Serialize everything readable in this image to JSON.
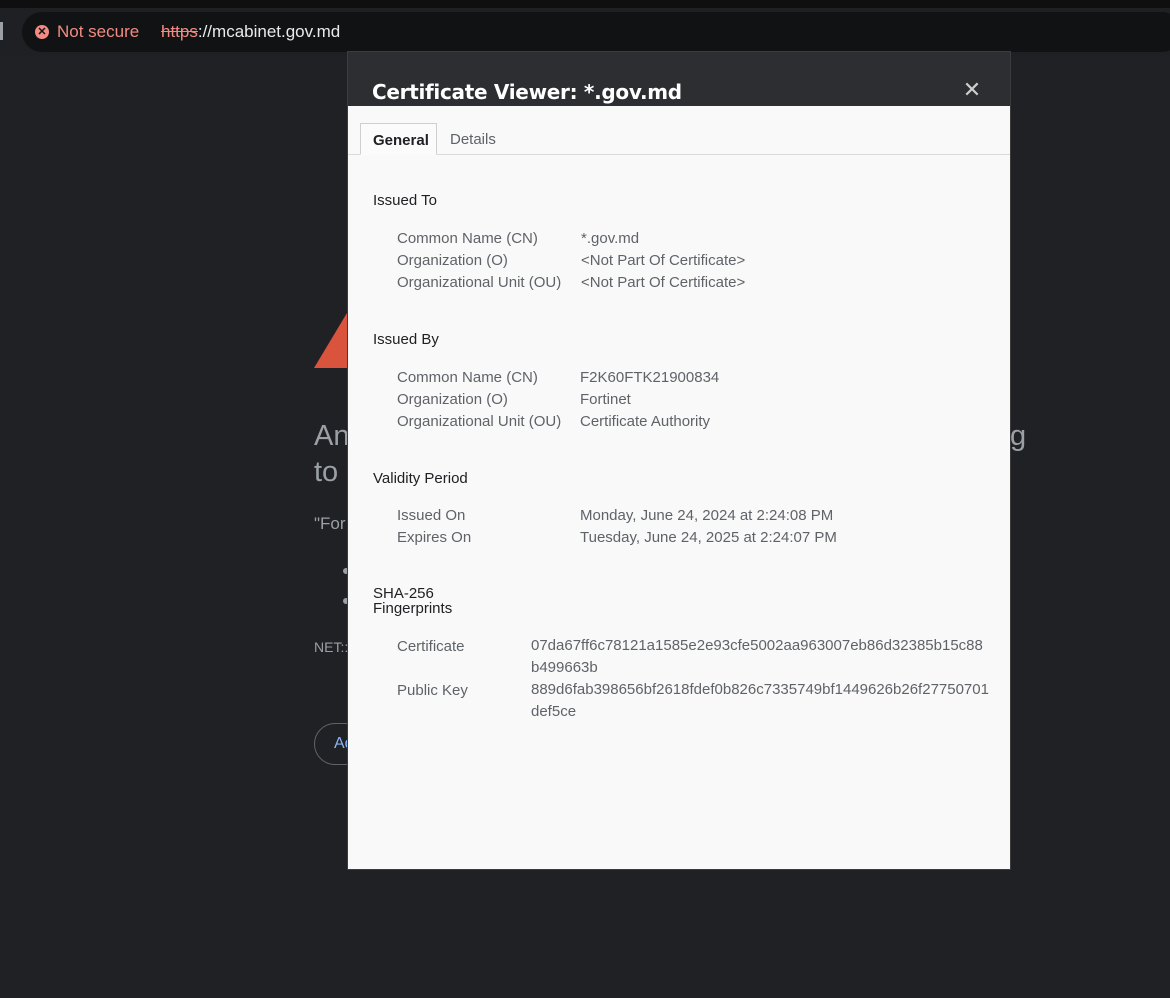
{
  "browser": {
    "security_label": "Not secure",
    "url_scheme": "https",
    "url_rest": "://mcabinet.gov.md"
  },
  "background_page": {
    "heading_line1": "An",
    "heading_line2": "to",
    "heading_right": "g",
    "quote_fragment": "\"For",
    "error_code_fragment": "NET::",
    "button_fragment": "Ad"
  },
  "dialog": {
    "title": "Certificate Viewer: *.gov.md",
    "close_glyph": "✕",
    "tabs": {
      "general": "General",
      "details": "Details"
    },
    "issued_to": {
      "title": "Issued To",
      "cn_label": "Common Name (CN)",
      "cn_value": "*.gov.md",
      "o_label": "Organization (O)",
      "o_value": "<Not Part Of Certificate>",
      "ou_label": "Organizational Unit (OU)",
      "ou_value": "<Not Part Of Certificate>"
    },
    "issued_by": {
      "title": "Issued By",
      "cn_label": "Common Name (CN)",
      "cn_value": "F2K60FTK21900834",
      "o_label": "Organization (O)",
      "o_value": "Fortinet",
      "ou_label": "Organizational Unit (OU)",
      "ou_value": "Certificate Authority"
    },
    "validity": {
      "title": "Validity Period",
      "issued_label": "Issued On",
      "issued_value": "Monday, June 24, 2024 at 2:24:08 PM",
      "expires_label": "Expires On",
      "expires_value": "Tuesday, June 24, 2025 at 2:24:07 PM"
    },
    "fingerprints": {
      "title_line1": "SHA-256",
      "title_line2": "Fingerprints",
      "cert_label": "Certificate",
      "cert_value": "07da67ff6c78121a1585e2e93cfe5002aa963007eb86d32385b15c88b499663b",
      "pubkey_label": "Public Key",
      "pubkey_value": "889d6fab398656bf2618fdef0b826c7335749bf1449626b26f27750701def5ce"
    }
  }
}
